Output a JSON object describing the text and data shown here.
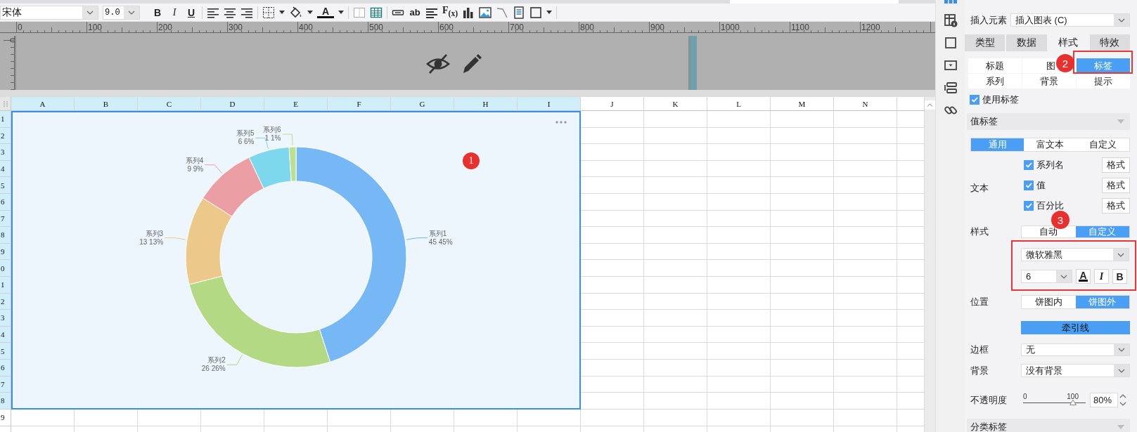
{
  "toolbar": {
    "font": "宋体",
    "size": "9.0",
    "bold": "B",
    "italic": "I",
    "underline": "U",
    "font_color": "A",
    "text_tool": "ab",
    "formula": "F$_{(x)}$"
  },
  "ruler": {
    "marks": [
      "0",
      "100",
      "200",
      "300",
      "400",
      "500",
      "600",
      "700",
      "800",
      "900",
      "1000",
      "1100",
      "1200"
    ],
    "vertical_mark": "0"
  },
  "sheet": {
    "columns": [
      {
        "label": "A",
        "selected": true
      },
      {
        "label": "B",
        "selected": true
      },
      {
        "label": "C",
        "selected": true
      },
      {
        "label": "D",
        "selected": true
      },
      {
        "label": "E",
        "selected": true
      },
      {
        "label": "F",
        "selected": true
      },
      {
        "label": "G",
        "selected": true
      },
      {
        "label": "H",
        "selected": true
      },
      {
        "label": "I",
        "selected": true
      },
      {
        "label": "J",
        "selected": false
      },
      {
        "label": "K",
        "selected": false
      },
      {
        "label": "L",
        "selected": false
      },
      {
        "label": "M",
        "selected": false
      },
      {
        "label": "N",
        "selected": false
      }
    ],
    "rows": [
      {
        "label": "1",
        "selected": true
      },
      {
        "label": "2",
        "selected": true
      },
      {
        "label": "3",
        "selected": true
      },
      {
        "label": "4",
        "selected": true
      },
      {
        "label": "5",
        "selected": true
      },
      {
        "label": "6",
        "selected": true
      },
      {
        "label": "7",
        "selected": true
      },
      {
        "label": "8",
        "selected": true
      },
      {
        "label": "9",
        "selected": true
      },
      {
        "label": "0",
        "selected": true
      },
      {
        "label": "1",
        "selected": true
      },
      {
        "label": "2",
        "selected": true
      },
      {
        "label": "3",
        "selected": true
      },
      {
        "label": "4",
        "selected": true
      },
      {
        "label": "5",
        "selected": true
      },
      {
        "label": "6",
        "selected": true
      },
      {
        "label": "7",
        "selected": true
      },
      {
        "label": "8",
        "selected": true
      },
      {
        "label": "9",
        "selected": false
      }
    ]
  },
  "chart": {
    "chart_data": {
      "type": "donut",
      "categories": [
        "系列1",
        "系列2",
        "系列3",
        "系列4",
        "系列5",
        "系列6"
      ],
      "values": [
        45,
        26,
        13,
        9,
        6,
        1
      ],
      "colors": [
        "#76b7f5",
        "#b3d985",
        "#ecc98a",
        "#eb9ea4",
        "#7dd8ee",
        "#b9e08e"
      ],
      "data_labels": true,
      "value_labels": [
        "45  45%",
        "26  26%",
        "13  13%",
        "9  9%",
        "6  6%",
        "1  1%"
      ]
    }
  },
  "annotations": [
    {
      "text": "1"
    },
    {
      "text": "2"
    },
    {
      "text": "3"
    }
  ],
  "panel": {
    "insert_element": {
      "label": "插入元素",
      "value": "插入图表 (C)"
    },
    "tabs": [
      {
        "label": "类型",
        "selected": false
      },
      {
        "label": "数据",
        "selected": false
      },
      {
        "label": "样式",
        "selected": true
      },
      {
        "label": "特效",
        "selected": false
      }
    ],
    "subtabs": [
      {
        "label": "标题",
        "selected": false
      },
      {
        "label": "图",
        "selected": false
      },
      {
        "label": "标签",
        "selected": true
      },
      {
        "label": "系列",
        "selected": false
      },
      {
        "label": "背景",
        "selected": false
      },
      {
        "label": "提示",
        "selected": false
      }
    ],
    "use_labels": {
      "label": "使用标签",
      "checked": true
    },
    "value_label_section": "值标签",
    "label_modes": [
      {
        "label": "通用",
        "selected": true
      },
      {
        "label": "富文本",
        "selected": false
      },
      {
        "label": "自定义",
        "selected": false
      }
    ],
    "text_label": "文本",
    "text_options": [
      {
        "label": "系列名",
        "checked": true,
        "button": "格式"
      },
      {
        "label": "值",
        "checked": true,
        "button": "格式"
      },
      {
        "label": "百分比",
        "checked": true,
        "button": "格式"
      }
    ],
    "style_label": "样式",
    "style_modes": [
      {
        "label": "自动",
        "selected": false
      },
      {
        "label": "自定义",
        "selected": true
      }
    ],
    "font": "微软雅黑",
    "font_size": "6",
    "color_glyph": "A",
    "italic": "I",
    "bold": "B",
    "position_label": "位置",
    "positions": [
      {
        "label": "饼图内",
        "selected": false
      },
      {
        "label": "饼图外",
        "selected": true
      }
    ],
    "leader_line": {
      "label": "牵引线",
      "on": true
    },
    "border": {
      "label": "边框",
      "value": "无"
    },
    "background": {
      "label": "背景",
      "value": "没有背景"
    },
    "opacity": {
      "label": "不透明度",
      "min": "0",
      "max": "100",
      "level": 0.8,
      "value": "80%"
    },
    "category_section": "分类标签"
  }
}
